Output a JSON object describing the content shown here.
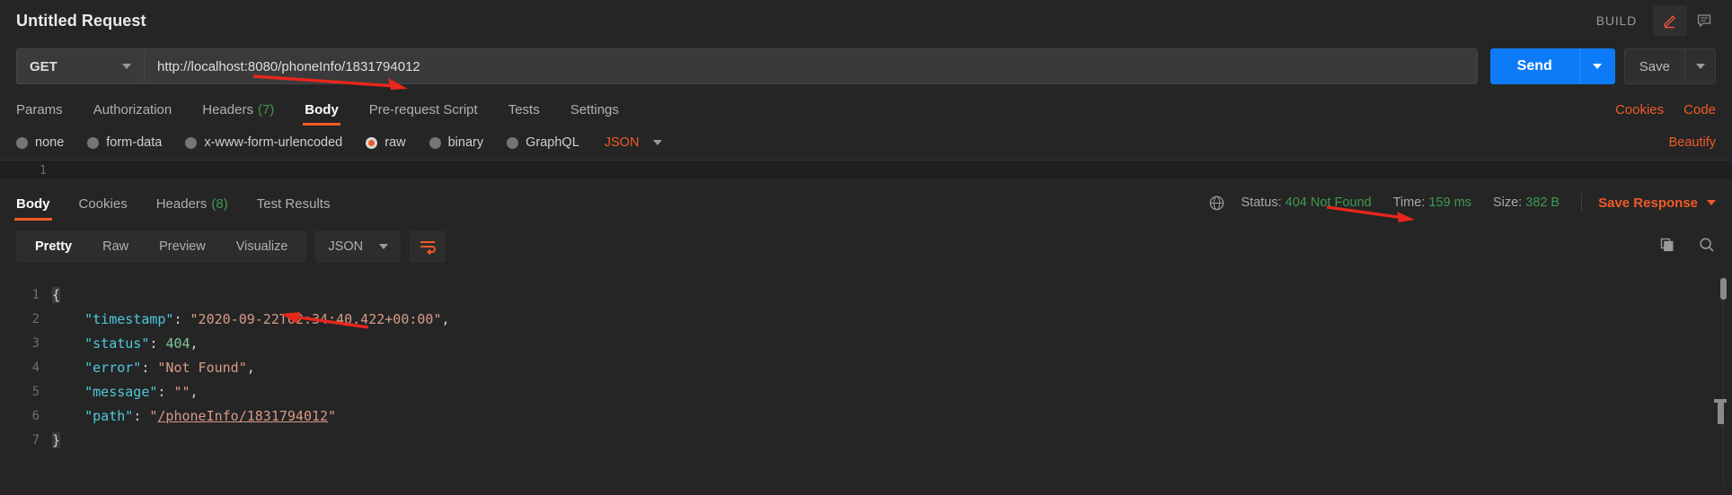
{
  "titlebar": {
    "request_title": "Untitled Request",
    "build_label": "BUILD",
    "edit_icon": "pencil-icon",
    "comment_icon": "comment-icon"
  },
  "urlbar": {
    "method": "GET",
    "url": "http://localhost:8080/phoneInfo/1831794012",
    "send_label": "Send",
    "save_label": "Save"
  },
  "request_tabs": {
    "items": [
      {
        "label": "Params",
        "count": "",
        "active": false
      },
      {
        "label": "Authorization",
        "count": "",
        "active": false
      },
      {
        "label": "Headers",
        "count": "(7)",
        "active": false
      },
      {
        "label": "Body",
        "count": "",
        "active": true
      },
      {
        "label": "Pre-request Script",
        "count": "",
        "active": false
      },
      {
        "label": "Tests",
        "count": "",
        "active": false
      },
      {
        "label": "Settings",
        "count": "",
        "active": false
      }
    ],
    "cookies_link": "Cookies",
    "code_link": "Code"
  },
  "body_type": {
    "options": [
      {
        "label": "none",
        "selected": false
      },
      {
        "label": "form-data",
        "selected": false
      },
      {
        "label": "x-www-form-urlencoded",
        "selected": false
      },
      {
        "label": "raw",
        "selected": true
      },
      {
        "label": "binary",
        "selected": false
      },
      {
        "label": "GraphQL",
        "selected": false
      }
    ],
    "content_type": "JSON",
    "beautify_label": "Beautify",
    "editor_line_number": "1"
  },
  "response": {
    "tabs": [
      {
        "label": "Body",
        "count": "",
        "active": true
      },
      {
        "label": "Cookies",
        "count": "",
        "active": false
      },
      {
        "label": "Headers",
        "count": "(8)",
        "active": false
      },
      {
        "label": "Test Results",
        "count": "",
        "active": false
      }
    ],
    "globe_icon": "globe-icon",
    "status_label": "Status:",
    "status_value": "404 Not Found",
    "time_label": "Time:",
    "time_value": "159 ms",
    "size_label": "Size:",
    "size_value": "382 B",
    "save_response_label": "Save Response"
  },
  "response_toolbar": {
    "views": [
      {
        "label": "Pretty",
        "active": true
      },
      {
        "label": "Raw",
        "active": false
      },
      {
        "label": "Preview",
        "active": false
      },
      {
        "label": "Visualize",
        "active": false
      }
    ],
    "format": "JSON",
    "wrap_icon": "word-wrap-icon",
    "copy_icon": "copy-icon",
    "search_icon": "search-icon"
  },
  "code": {
    "lines": [
      {
        "num": "1",
        "tokens": [
          {
            "t": "brace",
            "v": "{"
          }
        ]
      },
      {
        "num": "2",
        "tokens": [
          {
            "t": "p",
            "v": "    "
          },
          {
            "t": "k",
            "v": "\"timestamp\""
          },
          {
            "t": "p",
            "v": ": "
          },
          {
            "t": "s",
            "v": "\"2020-09-22T02:34:40.422+00:00\""
          },
          {
            "t": "p",
            "v": ","
          }
        ]
      },
      {
        "num": "3",
        "tokens": [
          {
            "t": "p",
            "v": "    "
          },
          {
            "t": "k",
            "v": "\"status\""
          },
          {
            "t": "p",
            "v": ": "
          },
          {
            "t": "n",
            "v": "404"
          },
          {
            "t": "p",
            "v": ","
          }
        ]
      },
      {
        "num": "4",
        "tokens": [
          {
            "t": "p",
            "v": "    "
          },
          {
            "t": "k",
            "v": "\"error\""
          },
          {
            "t": "p",
            "v": ": "
          },
          {
            "t": "s",
            "v": "\"Not Found\""
          },
          {
            "t": "p",
            "v": ","
          }
        ]
      },
      {
        "num": "5",
        "tokens": [
          {
            "t": "p",
            "v": "    "
          },
          {
            "t": "k",
            "v": "\"message\""
          },
          {
            "t": "p",
            "v": ": "
          },
          {
            "t": "s",
            "v": "\"\""
          },
          {
            "t": "p",
            "v": ","
          }
        ]
      },
      {
        "num": "6",
        "tokens": [
          {
            "t": "p",
            "v": "    "
          },
          {
            "t": "k",
            "v": "\"path\""
          },
          {
            "t": "p",
            "v": ": "
          },
          {
            "t": "s",
            "v": "\""
          },
          {
            "t": "su",
            "v": "/phoneInfo/1831794012"
          },
          {
            "t": "s",
            "v": "\""
          }
        ]
      },
      {
        "num": "7",
        "tokens": [
          {
            "t": "brace",
            "v": "}"
          }
        ]
      }
    ]
  },
  "colors": {
    "accent_orange": "#ef5b25",
    "send_blue": "#0d7bf7",
    "status_green": "#3d9b50",
    "background": "#252526",
    "annotation_red": "#e8261c"
  },
  "annotations": [
    {
      "name": "arrow-to-url-bar"
    },
    {
      "name": "arrow-to-status"
    },
    {
      "name": "arrow-to-error-field"
    }
  ]
}
